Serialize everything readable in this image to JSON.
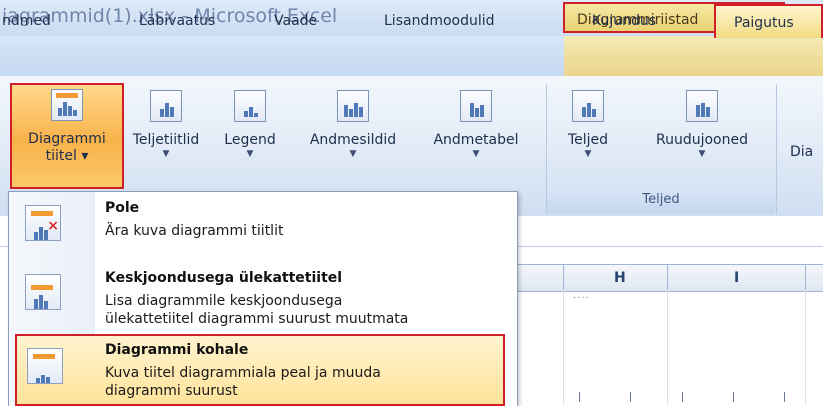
{
  "window": {
    "title": "iagrammid(1).xlsx - Microsoft Excel",
    "context_title": "Diagrammiriistad"
  },
  "tabs": [
    {
      "label": "ndmed"
    },
    {
      "label": "Läbivaatus"
    },
    {
      "label": "Vaade"
    },
    {
      "label": "Lisandmoodulid"
    },
    {
      "label": "Kujundus"
    },
    {
      "label": "Paigutus"
    }
  ],
  "ribbon": {
    "buttons": [
      {
        "line1": "Diagrammi",
        "line2": "tiitel ▾",
        "icon": "chart-title-icon"
      },
      {
        "label": "Teljetiitlid",
        "icon": "axis-titles-icon"
      },
      {
        "label": "Legend",
        "icon": "legend-icon"
      },
      {
        "label": "Andmesildid",
        "icon": "data-labels-icon"
      },
      {
        "label": "Andmetabel",
        "icon": "data-table-icon"
      },
      {
        "label": "Teljed",
        "icon": "axes-icon"
      },
      {
        "label": "Ruudujooned",
        "icon": "gridlines-icon"
      },
      {
        "label": "Dia",
        "icon": "chart-area-icon"
      }
    ],
    "group_labels": {
      "axes": "Teljed"
    }
  },
  "sheet": {
    "columns": [
      "H",
      "I"
    ]
  },
  "menu": {
    "items": [
      {
        "title": "Pole",
        "desc1": "Ära kuva diagrammi tiitlit",
        "icon": "no-title-icon"
      },
      {
        "title": "Keskjoondusega ülekattetiitel",
        "desc1": "Lisa diagrammile keskjoondusega",
        "desc2": "ülekattetiitel diagrammi suurust muutmata",
        "icon": "overlay-title-icon"
      },
      {
        "title": "Diagrammi kohale",
        "desc1": "Kuva tiitel diagrammiala peal ja muuda",
        "desc2": "diagrammi suurust",
        "icon": "above-chart-title-icon"
      }
    ]
  },
  "colors": {
    "highlight_border": "#d11f2a",
    "ribbon_bg": "#dfe9f6",
    "active_button": "#f8b24a"
  }
}
